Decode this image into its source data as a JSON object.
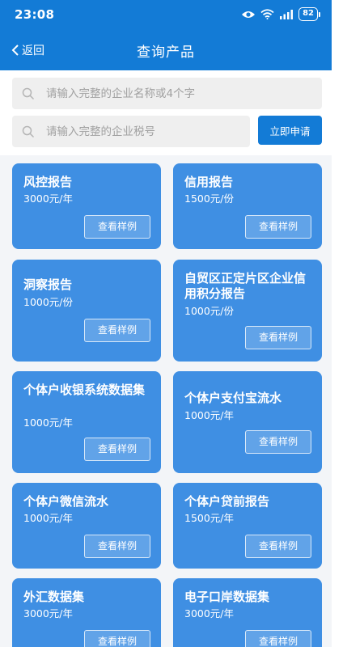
{
  "status_bar": {
    "time": "23:08",
    "battery": "82",
    "icons": [
      "eye-icon",
      "wifi-icon",
      "signal-icon",
      "battery-icon"
    ]
  },
  "navbar": {
    "back_label": "返回",
    "title": "查询产品"
  },
  "search": {
    "name_placeholder": "请输入完整的企业名称或4个字",
    "tax_placeholder": "请输入完整的企业税号",
    "name_value": "",
    "tax_value": "",
    "apply_label": "立即申请"
  },
  "colors": {
    "primary": "#137bd6",
    "card": "#3f8fe3",
    "background": "#f3f5f8"
  },
  "products": [
    {
      "title": "风控报告",
      "price": "3000元/年",
      "button": "查看样例"
    },
    {
      "title": "信用报告",
      "price": "1500元/份",
      "button": "查看样例"
    },
    {
      "title": "洞察报告",
      "price": "1000元/份",
      "button": "查看样例"
    },
    {
      "title": "自贸区正定片区企业信用积分报告",
      "price": "1000元/份",
      "button": "查看样例"
    },
    {
      "title": "个体户收银系统数据集",
      "price": "1000元/年",
      "button": "查看样例"
    },
    {
      "title": "个体户支付宝流水",
      "price": "1000元/年",
      "button": "查看样例"
    },
    {
      "title": "个体户微信流水",
      "price": "1000元/年",
      "button": "查看样例"
    },
    {
      "title": "个体户贷前报告",
      "price": "1500元/年",
      "button": "查看样例"
    },
    {
      "title": "外汇数据集",
      "price": "3000元/年",
      "button": "查看样例"
    },
    {
      "title": "电子口岸数据集",
      "price": "3000元/年",
      "button": "查看样例"
    }
  ]
}
